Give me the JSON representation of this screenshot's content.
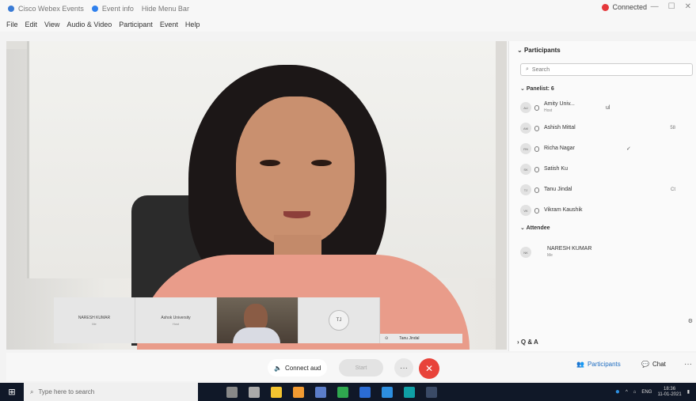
{
  "window": {
    "title_segments": [
      "Cisco Webex Events",
      "Event info",
      "Hide Menu Bar"
    ],
    "status": "Connected",
    "controls": [
      "—",
      "☐",
      "✕"
    ]
  },
  "menu": [
    "File",
    "Edit",
    "View",
    "Audio & Video",
    "Participant",
    "Event",
    "Help"
  ],
  "thumbnails": [
    {
      "name": "NARESH KUMAR",
      "sub": "Me"
    },
    {
      "name": "Ashok University",
      "sub": "Host"
    },
    {
      "name": "",
      "sub": ""
    },
    {
      "name": "",
      "avatar": "TJ"
    }
  ],
  "active_speaker": {
    "name": "Tanu Jindal"
  },
  "controls_bar": {
    "connect_audio": "Connect aud",
    "start_video": "Start",
    "more": "···",
    "end": "✕",
    "participants": "Participants",
    "chat": "Chat",
    "overflow": "···"
  },
  "panel": {
    "title": "Participants",
    "search_placeholder": "Search",
    "panelists_label": "Panelist: 6",
    "attendee_label": "Attendee",
    "qa_label": "Q & A",
    "panelists": [
      {
        "initials": "AU",
        "name": "Amity Univ...",
        "role": "Host",
        "mid": "ul"
      },
      {
        "initials": "AM",
        "name": "Ashish Mittal",
        "role": "",
        "right": "58"
      },
      {
        "initials": "RN",
        "name": "Richa Nagar",
        "role": "",
        "mid": "✓"
      },
      {
        "initials": "SK",
        "name": "Satish Ku",
        "role": ""
      },
      {
        "initials": "TJ",
        "name": "Tanu Jindal",
        "role": "",
        "right": "Ct"
      },
      {
        "initials": "VK",
        "name": "Vikram Kaushik",
        "role": ""
      }
    ],
    "attendees": [
      {
        "initials": "NK",
        "name": "NARESH KUMAR",
        "role": "Me"
      }
    ]
  },
  "taskbar": {
    "search_placeholder": "Type here to search",
    "tray_lang": "ENG",
    "tray_time": "18:36",
    "tray_date": "11-01-2021"
  },
  "colors": {
    "accent": "#1e6dc1",
    "end_call": "#e8433a",
    "status_red": "#e5383b",
    "taskbar": "#101828"
  }
}
